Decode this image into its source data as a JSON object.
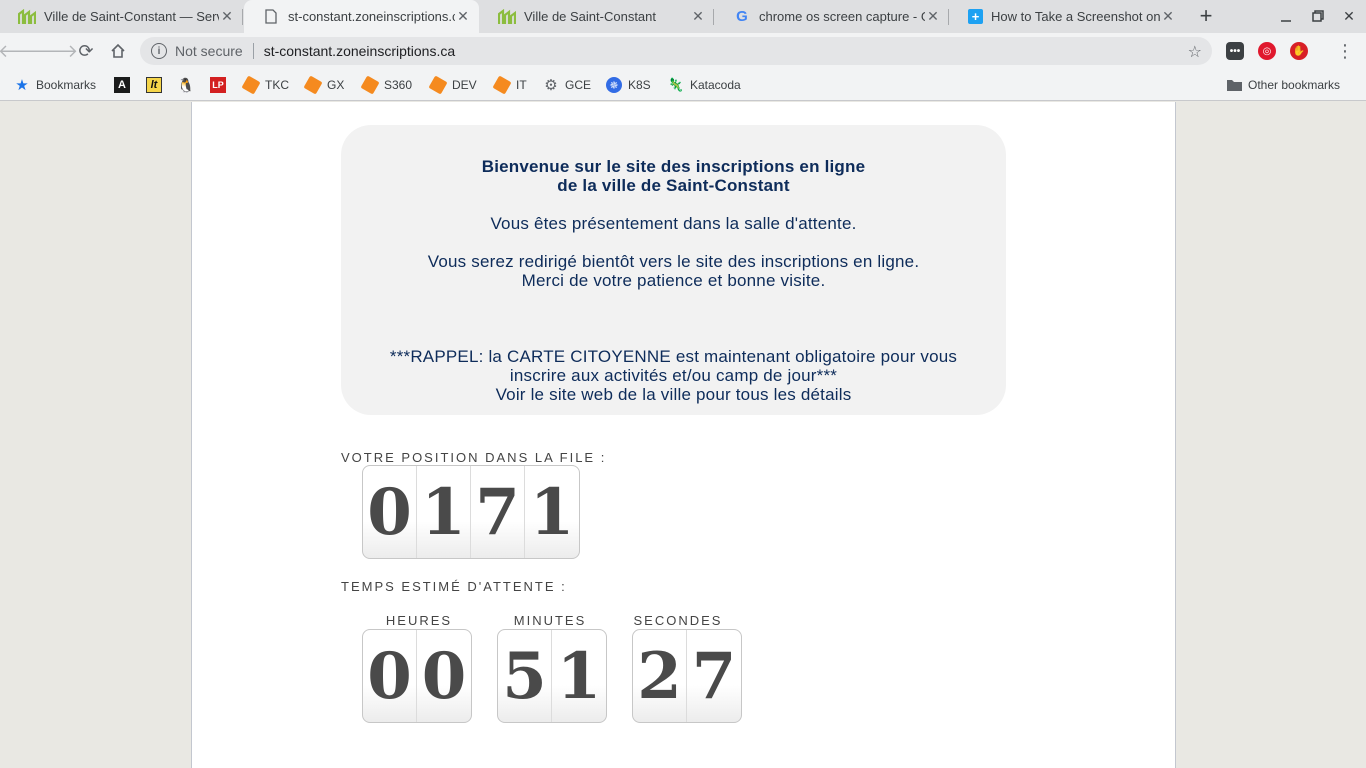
{
  "tabs": [
    {
      "title": "Ville de Saint-Constant — Servic",
      "favicon": "saint-constant-logo-icon",
      "active": false
    },
    {
      "title": "st-constant.zoneinscriptions.ca",
      "favicon": "page-icon",
      "active": true
    },
    {
      "title": "Ville de Saint-Constant",
      "favicon": "saint-constant-logo-icon",
      "active": false
    },
    {
      "title": "chrome os screen capture - Goo",
      "favicon": "google-icon",
      "active": false
    },
    {
      "title": "How to Take a Screenshot on a",
      "favicon": "plus-box-icon",
      "active": false
    }
  ],
  "omnibox": {
    "security": "Not secure",
    "url": "st-constant.zoneinscriptions.ca"
  },
  "bookmarks": [
    {
      "label": "Bookmarks",
      "icon": "star-icon"
    },
    {
      "label": "",
      "icon": "a-logo-icon"
    },
    {
      "label": "",
      "icon": "lt-logo-icon"
    },
    {
      "label": "",
      "icon": "penguin-icon"
    },
    {
      "label": "",
      "icon": "lp-logo-icon"
    },
    {
      "label": "TKC",
      "icon": "cube-icon"
    },
    {
      "label": "GX",
      "icon": "cube-icon"
    },
    {
      "label": "S360",
      "icon": "cube-icon"
    },
    {
      "label": "DEV",
      "icon": "cube-icon"
    },
    {
      "label": "IT",
      "icon": "cube-icon"
    },
    {
      "label": "GCE",
      "icon": "gear-icon"
    },
    {
      "label": "K8S",
      "icon": "helm-icon"
    },
    {
      "label": "Katacoda",
      "icon": "katacoda-icon"
    }
  ],
  "other_bookmarks": "Other bookmarks",
  "message": {
    "heading_line1": "Bienvenue sur le site des inscriptions en ligne",
    "heading_line2": "de la ville de Saint-Constant",
    "waiting": "Vous êtes présentement dans la salle d'attente.",
    "redirect_line1": "Vous serez redirigé bientôt vers le site des inscriptions en ligne.",
    "redirect_line2": "Merci de votre patience et bonne visite.",
    "reminder_line1": "***RAPPEL: la CARTE CITOYENNE est maintenant obligatoire pour vous",
    "reminder_line2": "inscrire aux activités et/ou camp de jour***",
    "reminder_line3": "Voir le site web de la ville pour tous les détails"
  },
  "queue": {
    "position_label": "VOTRE POSITION DANS LA FILE :",
    "position_digits": [
      "0",
      "1",
      "7",
      "1"
    ],
    "wait_label": "TEMPS ESTIMÉ D'ATTENTE :",
    "hours_label": "HEURES",
    "hours_digits": [
      "0",
      "0"
    ],
    "minutes_label": "MINUTES",
    "minutes_digits": [
      "5",
      "1"
    ],
    "seconds_label": "SECONDES",
    "seconds_digits": [
      "2",
      "7"
    ]
  },
  "colors": {
    "message_text": "#0e2c5a",
    "message_bg": "#f2f2f2",
    "digit": "#4a4a4a",
    "page_bg": "#e9e8e3"
  }
}
